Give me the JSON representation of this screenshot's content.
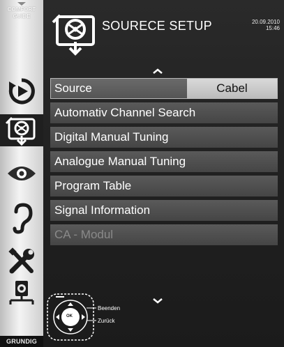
{
  "sidebar": {
    "comfort_line1": "COMFORT",
    "comfort_line2": "GUIDE",
    "brand": "GRUNDIG",
    "icons": [
      "source-icon",
      "source-setup-icon",
      "picture-icon",
      "sound-icon",
      "settings-icon",
      "network-icon"
    ]
  },
  "header": {
    "title": "SOURECE SETUP",
    "date": "20.09.2010",
    "time": "15:46"
  },
  "menu": {
    "source_label": "Source",
    "source_value": "Cabel",
    "items": [
      "Automativ Channel Search",
      "Digital Manual Tuning",
      "Analogue Manual Tuning",
      "Program Table",
      "Signal Information",
      "CA - Modul"
    ]
  },
  "remote": {
    "ok_label": "OK",
    "exit_label": "Beenden",
    "back_label": "Zurück"
  }
}
